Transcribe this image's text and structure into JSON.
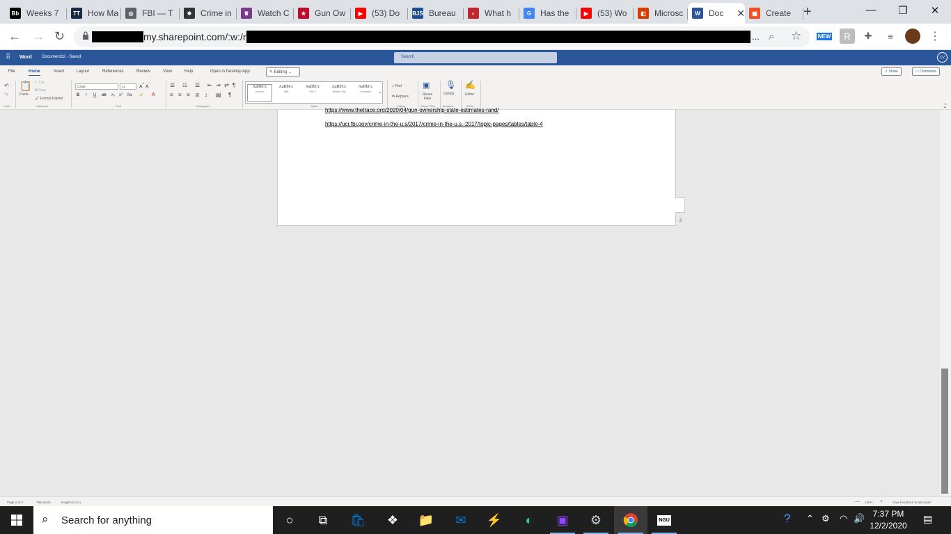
{
  "browser": {
    "tabs": [
      {
        "title": "Weeks 7",
        "favicon": "blackboard-icon",
        "color": "#000000",
        "glyph": "Bb"
      },
      {
        "title": "How Ma",
        "favicon": "the-trace-icon",
        "color": "#1a2a44",
        "glyph": "TT"
      },
      {
        "title": "FBI — T",
        "favicon": "globe-icon",
        "color": "#5f6368",
        "glyph": "◎"
      },
      {
        "title": "Crime in",
        "favicon": "fbi-seal-icon",
        "color": "#333333",
        "glyph": "✸"
      },
      {
        "title": "Watch C",
        "favicon": "crest-icon",
        "color": "#7a3a8a",
        "glyph": "♛"
      },
      {
        "title": "Gun Ow",
        "favicon": "texas-flag-icon",
        "color": "#bf0a30",
        "glyph": "★"
      },
      {
        "title": "(53) Do",
        "favicon": "youtube-icon",
        "color": "#ff0000",
        "glyph": "▶"
      },
      {
        "title": "Bureau",
        "favicon": "bjs-icon",
        "color": "#1f4e8c",
        "glyph": "BJS"
      },
      {
        "title": "What h",
        "favicon": "red-logo-icon",
        "color": "#c0262d",
        "glyph": "◐"
      },
      {
        "title": "Has the",
        "favicon": "google-icon",
        "color": "#4285f4",
        "glyph": "G"
      },
      {
        "title": "(53) Wo",
        "favicon": "youtube-icon",
        "color": "#ff0000",
        "glyph": "▶"
      },
      {
        "title": "Microsc",
        "favicon": "office-icon",
        "color": "#d83b01",
        "glyph": "◧"
      },
      {
        "title": "Doc",
        "favicon": "word-icon",
        "color": "#2b579a",
        "glyph": "W",
        "active": true
      },
      {
        "title": "Create",
        "favicon": "microsoft-icon",
        "color": "#f25022",
        "glyph": "▦"
      }
    ],
    "url_visible": "my.sharepoint.com/:w:/r",
    "url_ellipsis": "...",
    "ext_new_badge": "NEW"
  },
  "word": {
    "app_name": "Word",
    "doc_title": "Document12 - Saved",
    "search_placeholder": "Search",
    "avatar_initials": "CV",
    "ribbon_tabs": [
      "File",
      "Home",
      "Insert",
      "Layout",
      "References",
      "Review",
      "View",
      "Help",
      "Open in Desktop App"
    ],
    "editing_mode": "Editing",
    "share_label": "Share",
    "comments_label": "Comments",
    "ribbon": {
      "undo_group": "Undo",
      "paste": "Paste",
      "cut": "Cut",
      "copy": "Copy",
      "format_painter": "Format Painter",
      "clipboard_group": "Clipboard",
      "font_name": "Calibri",
      "font_size": "11",
      "font_group": "Font",
      "paragraph_group": "Paragraph",
      "styles_group": "Styles",
      "styles": [
        {
          "sample": "AaBbCc",
          "name": "Normal"
        },
        {
          "sample": "AaBbCc",
          "name": "Title"
        },
        {
          "sample": "AaBbCc",
          "name": "Title 2"
        },
        {
          "sample": "AaBbCc",
          "name": "Section Title"
        },
        {
          "sample": "AaBbCc",
          "name": "Emphasis"
        }
      ],
      "find": "Find",
      "replace": "Replace",
      "editing_group": "Editing",
      "reuse_files": "Reuse Files",
      "reuse_group": "Reuse Files",
      "dictate": "Dictate",
      "dictation_group": "Dictation",
      "editor": "Editor",
      "editor_group": "Editor"
    },
    "document": {
      "links": [
        "https://www.thetrace.org/2020/04/gun-ownership-state-estimates-rand/",
        "https://ucr.fbi.gov/crime-in-the-u.s/2017/crime-in-the-u.s.-2017/topic-pages/tables/table-4"
      ],
      "page_number": "2"
    },
    "status": {
      "page": "Page 2 of 2",
      "words": "799 words",
      "language": "English (U.S.)",
      "zoom": "140%",
      "feedback": "Give Feedback to Microsoft"
    }
  },
  "taskbar": {
    "search_placeholder": "Search for anything",
    "time": "7:37 PM",
    "date": "12/2/2020",
    "ngu_label": "NGU"
  }
}
